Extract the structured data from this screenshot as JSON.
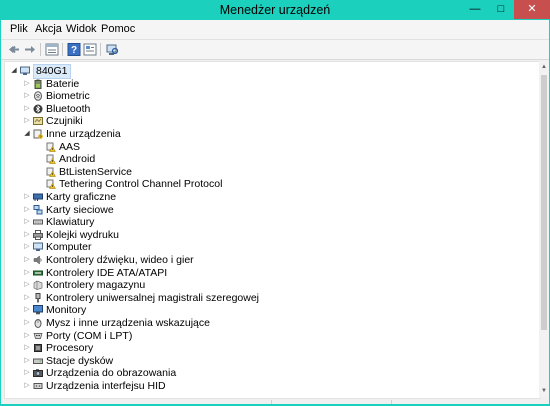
{
  "window": {
    "title": "Menedżer urządzeń",
    "controls": {
      "minimize": "—",
      "maximize": "□",
      "close": "✕"
    },
    "accent_color": "#1bd0bd"
  },
  "menubar": {
    "items": [
      {
        "label": "Plik"
      },
      {
        "label": "Akcja"
      },
      {
        "label": "Widok"
      },
      {
        "label": "Pomoc"
      }
    ]
  },
  "toolbar": {
    "buttons": [
      {
        "icon": "back-arrow-icon"
      },
      {
        "icon": "forward-arrow-icon"
      },
      {
        "icon": "properties-view-icon"
      },
      {
        "icon": "help-icon"
      },
      {
        "icon": "driver-details-icon"
      },
      {
        "icon": "scan-hardware-icon"
      }
    ]
  },
  "tree": {
    "root": {
      "label": "840G1",
      "icon": "computer-icon",
      "expanded": true
    },
    "items": [
      {
        "label": "Baterie",
        "icon": "battery-icon",
        "level": 1,
        "expander": "collapsed"
      },
      {
        "label": "Biometric",
        "icon": "fingerprint-icon",
        "level": 1,
        "expander": "collapsed"
      },
      {
        "label": "Bluetooth",
        "icon": "bluetooth-icon",
        "level": 1,
        "expander": "collapsed"
      },
      {
        "label": "Czujniki",
        "icon": "sensor-icon",
        "level": 1,
        "expander": "collapsed"
      },
      {
        "label": "Inne urządzenia",
        "icon": "unknown-device-icon",
        "level": 1,
        "expander": "expanded"
      },
      {
        "label": "AAS",
        "icon": "warning-device-icon",
        "level": 2,
        "expander": "none"
      },
      {
        "label": "Android",
        "icon": "warning-device-icon",
        "level": 2,
        "expander": "none"
      },
      {
        "label": "BtListenService",
        "icon": "warning-device-icon",
        "level": 2,
        "expander": "none"
      },
      {
        "label": "Tethering Control Channel Protocol",
        "icon": "warning-device-icon",
        "level": 2,
        "expander": "none"
      },
      {
        "label": "Karty graficzne",
        "icon": "display-adapter-icon",
        "level": 1,
        "expander": "collapsed"
      },
      {
        "label": "Karty sieciowe",
        "icon": "network-adapter-icon",
        "level": 1,
        "expander": "collapsed"
      },
      {
        "label": "Klawiatury",
        "icon": "keyboard-icon",
        "level": 1,
        "expander": "collapsed"
      },
      {
        "label": "Kolejki wydruku",
        "icon": "printer-icon",
        "level": 1,
        "expander": "collapsed"
      },
      {
        "label": "Komputer",
        "icon": "computer-icon",
        "level": 1,
        "expander": "collapsed"
      },
      {
        "label": "Kontrolery dźwięku, wideo i gier",
        "icon": "speaker-icon",
        "level": 1,
        "expander": "collapsed"
      },
      {
        "label": "Kontrolery IDE ATA/ATAPI",
        "icon": "ide-controller-icon",
        "level": 1,
        "expander": "collapsed"
      },
      {
        "label": "Kontrolery magazynu",
        "icon": "storage-controller-icon",
        "level": 1,
        "expander": "collapsed"
      },
      {
        "label": "Kontrolery uniwersalnej magistrali szeregowej",
        "icon": "usb-icon",
        "level": 1,
        "expander": "collapsed"
      },
      {
        "label": "Monitory",
        "icon": "monitor-icon",
        "level": 1,
        "expander": "collapsed"
      },
      {
        "label": "Mysz i inne urządzenia wskazujące",
        "icon": "mouse-icon",
        "level": 1,
        "expander": "collapsed"
      },
      {
        "label": "Porty (COM i LPT)",
        "icon": "port-icon",
        "level": 1,
        "expander": "collapsed"
      },
      {
        "label": "Procesory",
        "icon": "processor-icon",
        "level": 1,
        "expander": "collapsed"
      },
      {
        "label": "Stacje dysków",
        "icon": "disk-drive-icon",
        "level": 1,
        "expander": "collapsed"
      },
      {
        "label": "Urządzenia do obrazowania",
        "icon": "camera-icon",
        "level": 1,
        "expander": "collapsed"
      },
      {
        "label": "Urządzenia interfejsu HID",
        "icon": "hid-icon",
        "level": 1,
        "expander": "collapsed"
      }
    ]
  }
}
